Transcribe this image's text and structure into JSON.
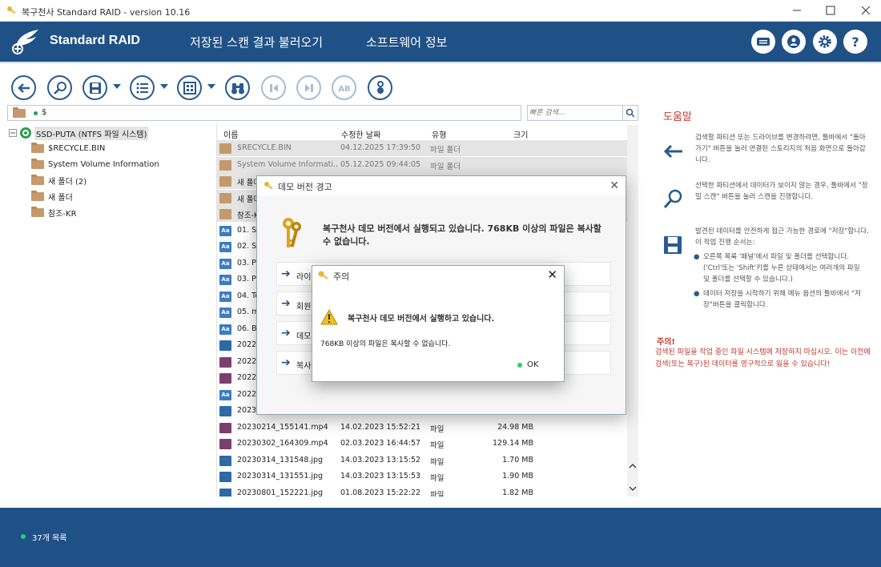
{
  "window": {
    "title": "복구천사 Standard RAID - version 10.16"
  },
  "header": {
    "brand": "Standard RAID",
    "menu": [
      "저장된 스캔 결과 불러오기",
      "소프트웨어 정보"
    ],
    "icons": [
      "keyboard-icon",
      "user-icon",
      "gear-icon",
      "help-icon"
    ]
  },
  "toolbar": {
    "buttons": [
      "back-icon",
      "search-icon",
      "save-icon",
      "list-icon",
      "view-icon",
      "binoculars-icon",
      "prev-icon",
      "next-icon",
      "match-case-icon",
      "info-icon"
    ]
  },
  "path": {
    "value": "$"
  },
  "search": {
    "placeholder": "빠른 검색..."
  },
  "tree": {
    "root": "SSD-PUTA (NTFS 파일 시스템)",
    "items": [
      "$RECYCLE.BIN",
      "System Volume Information",
      "새 폴더 (2)",
      "새 폴더",
      "참조-KR"
    ]
  },
  "list": {
    "columns": {
      "name": "이름",
      "date": "수정한 날짜",
      "type": "유형",
      "size": "크기"
    },
    "rows": [
      {
        "name": "$RECYCLE.BIN",
        "date": "04.12.2025 17:39:50",
        "type": "파일 폴더",
        "size": "",
        "icon": "folder"
      },
      {
        "name": "System Volume Informati...",
        "date": "05.12.2025 09:44:05",
        "type": "파일 폴더",
        "size": "",
        "icon": "folder"
      },
      {
        "name": "새 폴더",
        "date": "",
        "type": "",
        "size": "",
        "icon": "folder"
      },
      {
        "name": "새 폴더",
        "date": "",
        "type": "",
        "size": "",
        "icon": "folder"
      },
      {
        "name": "참조-K",
        "date": "",
        "type": "",
        "size": "",
        "icon": "folder"
      },
      {
        "name": "01. Sta",
        "date": "",
        "type": "",
        "size": "",
        "icon": "doc"
      },
      {
        "name": "02. Sta",
        "date": "",
        "type": "",
        "size": "",
        "icon": "doc"
      },
      {
        "name": "03. Pro",
        "date": "",
        "type": "",
        "size": "",
        "icon": "doc"
      },
      {
        "name": "03. Pro",
        "date": "",
        "type": "",
        "size": "",
        "icon": "doc"
      },
      {
        "name": "04. Tec",
        "date": "",
        "type": "",
        "size": "",
        "icon": "doc"
      },
      {
        "name": "05. my",
        "date": "",
        "type": "",
        "size": "",
        "icon": "doc"
      },
      {
        "name": "06. Bla",
        "date": "",
        "type": "",
        "size": "",
        "icon": "doc"
      },
      {
        "name": "202204",
        "date": "",
        "type": "",
        "size": "",
        "icon": "img"
      },
      {
        "name": "202206",
        "date": "",
        "type": "",
        "size": "",
        "icon": "vid"
      },
      {
        "name": "202206",
        "date": "",
        "type": "",
        "size": "",
        "icon": "vid"
      },
      {
        "name": "2022_0",
        "date": "",
        "type": "",
        "size": "",
        "icon": "doc"
      },
      {
        "name": "202302",
        "date": "",
        "type": "",
        "size": "",
        "icon": "img"
      },
      {
        "name": "20230214_155141.mp4",
        "date": "14.02.2023 15:52:21",
        "type": "파일",
        "size": "24.98 MB",
        "icon": "vid"
      },
      {
        "name": "20230302_164309.mp4",
        "date": "02.03.2023 16:44:57",
        "type": "파일",
        "size": "129.14 MB",
        "icon": "vid"
      },
      {
        "name": "20230314_131548.jpg",
        "date": "14.03.2023 13:15:52",
        "type": "파일",
        "size": "1.70 MB",
        "icon": "img"
      },
      {
        "name": "20230314_131551.jpg",
        "date": "14.03.2023 13:15:53",
        "type": "파일",
        "size": "1.90 MB",
        "icon": "img"
      },
      {
        "name": "20230801_152221.jpg",
        "date": "01.08.2023 15:22:22",
        "type": "파일",
        "size": "1.82 MB",
        "icon": "img"
      }
    ]
  },
  "help": {
    "title": "도움말",
    "items": [
      "검색할 파티션 또는 드라이브를 변경하려면, 툴바에서 \"돌아가기\" 버튼을 눌러 연결된 스토리지의 처음 화면으로 돌아갑니다.",
      "선택한 파티션에서 데이터가 보이지 않는 경우, 툴바에서 \"정밀 스캔\" 버튼을 눌러 스캔을 진행합니다.",
      "발견된 데이터를 안전하게 접근 가능한 경로에 \"저장\"합니다. 이 작업 진행 순서는:"
    ],
    "bullets": [
      "오른쪽 목록 '패널'에서 파일 및 폴더를 선택합니다. ('Ctrl'또는 'Shift'키를 누른 상태에서는 여러개의 파일 및 폴더를 선택할 수 있습니다.)",
      "데이터 저장을 시작하기 위해 메뉴 옵션의 툴바에서 \"저장\"버튼을 클릭합니다."
    ],
    "warn_title": "주의!",
    "warn_text": "검색된 파일을 작업 중인 파일 시스템에 저장하지 마십시오. 이는 이전에 검색(또는 복구)된 데이터를 영구적으로 잃을 수 있습니다!"
  },
  "status": {
    "text": "37개 목록"
  },
  "demo_dialog": {
    "title": "데모 버전 경고",
    "message": "복구천사 데모 버전에서 실행되고 있습니다. 768KB 이상의 파일은 복사할 수 없습니다.",
    "options": [
      "라이",
      "회원",
      "데모",
      "복사"
    ]
  },
  "alert_dialog": {
    "title": "주의",
    "message": "복구천사 데모 버전에서 실행하고 있습니다.",
    "detail": "768KB 이상의 파일은 복사할 수 없습니다.",
    "ok": "OK"
  },
  "colors": {
    "brand_blue": "#1f5187",
    "accent_red": "#c0392b",
    "ok_green": "#2ecc71"
  }
}
